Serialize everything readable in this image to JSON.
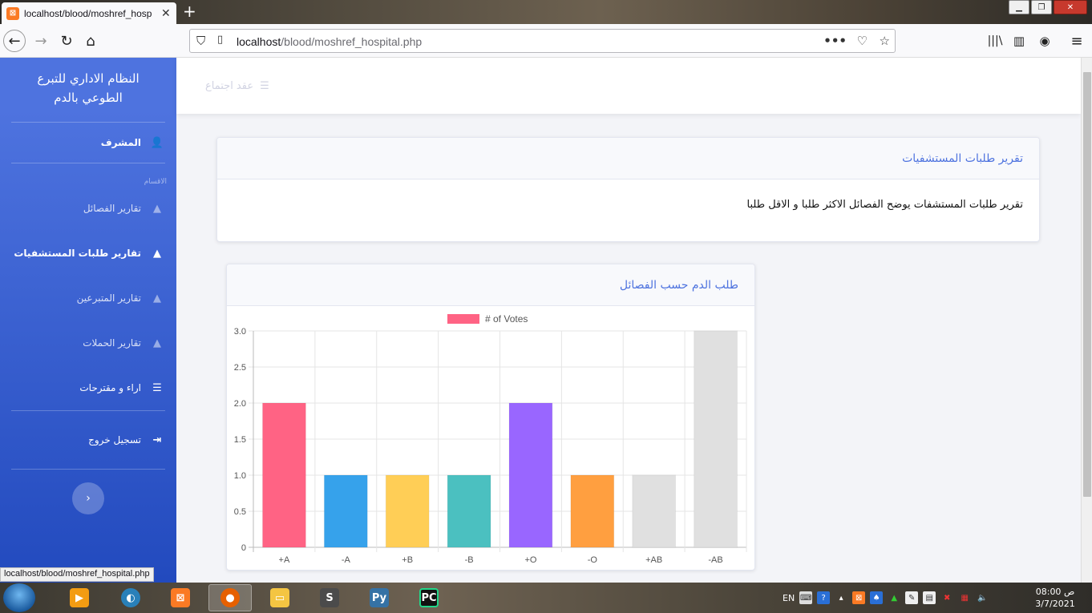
{
  "browser": {
    "tab_title": "localhost/blood/moshref_hosp",
    "url_host": "localhost",
    "url_path": "/blood/moshref_hospital.php",
    "status_link": "localhost/blood/moshref_hospital.php"
  },
  "sidebar": {
    "brand": "النظام الاداري للتبرع الطوعي بالدم",
    "admin": "المشرف",
    "section_heading": "الاقسام",
    "items": [
      {
        "label": "تقارير الفصائل",
        "icon": "area-chart-icon"
      },
      {
        "label": "تقارير طلبات المستشفيات",
        "icon": "area-chart-icon",
        "active": true
      },
      {
        "label": "تقارير المتبرعين",
        "icon": "area-chart-icon"
      },
      {
        "label": "تقارير الحملات",
        "icon": "area-chart-icon"
      },
      {
        "label": "اراء و مقترحات",
        "icon": "list-icon"
      }
    ],
    "logout": "تسجيل خروج"
  },
  "topbar": {
    "link": "عقد اجتماع"
  },
  "report_card": {
    "title": "تقرير طلبات المستشفيات",
    "body": "تقرير طلبات المستشفات يوضح الفصائل الاكثر طلبا و الاقل طلبا"
  },
  "chart_card": {
    "title": "طلب الدم حسب الفصائل"
  },
  "chart_data": {
    "type": "bar",
    "categories": [
      "A+",
      "A-",
      "B+",
      "B-",
      "O+",
      "O-",
      "AB+",
      "AB-"
    ],
    "tick_labels": [
      "+A",
      "-A",
      "+B",
      "-B",
      "+O",
      "-O",
      "+AB",
      "-AB"
    ],
    "series": [
      {
        "name": "# of Votes",
        "values": [
          2,
          1,
          1,
          1,
          2,
          1,
          1,
          3
        ]
      }
    ],
    "legend_label": "# of Votes",
    "colors": [
      "#ff6384",
      "#36a2eb",
      "#ffce56",
      "#4bc0c0",
      "#9966ff",
      "#ff9f40",
      "#e0e0e0",
      "#e0e0e0"
    ],
    "legend_color": "#ff6384",
    "ylim": [
      0,
      3
    ],
    "yticks": [
      "3.0",
      "2.5",
      "2.0",
      "1.5",
      "1.0",
      "0.5",
      "0"
    ],
    "grid": true,
    "legend_position": "top"
  },
  "taskbar": {
    "lang": "EN",
    "time": "08:00 ص",
    "date": "3/7/2021"
  }
}
